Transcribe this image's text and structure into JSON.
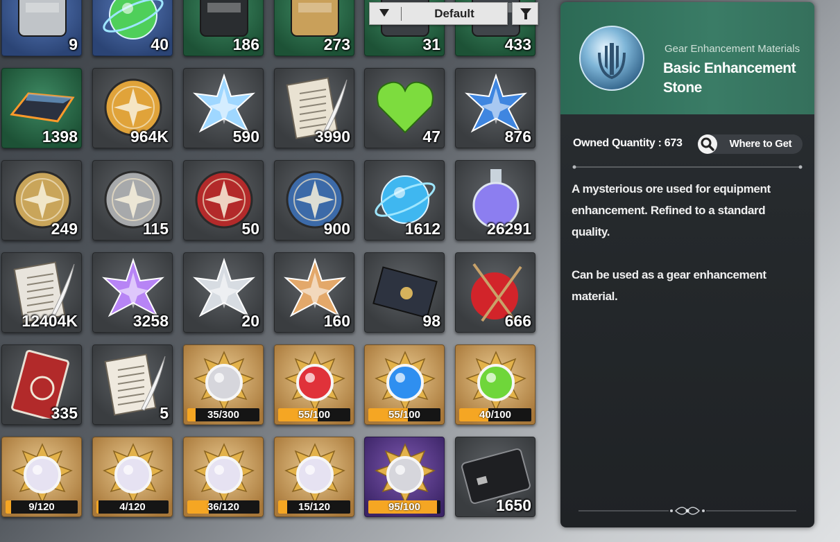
{
  "toolbar": {
    "sort_label": "Default"
  },
  "inventory": {
    "rows": [
      {
        "cut": true,
        "items": [
          {
            "qty": "9",
            "rarity": "blue",
            "icon": "knife-icon"
          },
          {
            "qty": "40",
            "rarity": "blue",
            "icon": "green-gem-icon"
          },
          {
            "qty": "186",
            "rarity": "green",
            "icon": "device-icon"
          },
          {
            "qty": "273",
            "rarity": "green",
            "icon": "brass-gear-icon"
          },
          {
            "qty": "31",
            "rarity": "green",
            "icon": "dark-blade-icon"
          },
          {
            "qty": "433",
            "rarity": "green",
            "icon": "dark-gadget-icon"
          }
        ]
      },
      {
        "items": [
          {
            "qty": "1398",
            "rarity": "green",
            "icon": "dark-ingot-icon"
          },
          {
            "qty": "964K",
            "rarity": "grey",
            "icon": "gold-coin-icon"
          },
          {
            "qty": "590",
            "rarity": "grey",
            "icon": "rainbow-crystal-icon"
          },
          {
            "qty": "3990",
            "rarity": "grey",
            "icon": "document-icon"
          },
          {
            "qty": "47",
            "rarity": "grey",
            "icon": "green-heart-icon"
          },
          {
            "qty": "876",
            "rarity": "grey",
            "icon": "blue-star-crystal-icon"
          }
        ]
      },
      {
        "items": [
          {
            "qty": "249",
            "rarity": "grey",
            "icon": "gold-compass-medal-icon"
          },
          {
            "qty": "115",
            "rarity": "grey",
            "icon": "crossed-axes-medal-icon"
          },
          {
            "qty": "50",
            "rarity": "grey",
            "icon": "red-eye-medal-icon"
          },
          {
            "qty": "900",
            "rarity": "grey",
            "icon": "blue-emblem-medal-icon"
          },
          {
            "qty": "1612",
            "rarity": "grey",
            "icon": "blue-orb-icon"
          },
          {
            "qty": "26291",
            "rarity": "grey",
            "icon": "potion-flask-icon"
          }
        ]
      },
      {
        "items": [
          {
            "qty": "12404K",
            "rarity": "grey",
            "icon": "quill-papers-icon"
          },
          {
            "qty": "3258",
            "rarity": "grey",
            "icon": "purple-star-crystal-icon"
          },
          {
            "qty": "20",
            "rarity": "grey",
            "icon": "silver-star-emblem-icon"
          },
          {
            "qty": "160",
            "rarity": "grey",
            "icon": "gold-star-emblem-icon"
          },
          {
            "qty": "98",
            "rarity": "grey",
            "icon": "sealed-envelope-icon"
          },
          {
            "qty": "666",
            "rarity": "grey",
            "icon": "yarn-ball-icon"
          }
        ]
      },
      {
        "items": [
          {
            "qty": "335",
            "rarity": "grey",
            "icon": "guild-ticket-icon"
          },
          {
            "qty": "5",
            "rarity": "grey",
            "icon": "scroll-quill-icon"
          },
          {
            "progress": "35/300",
            "fraction": 0.1167,
            "rarity": "gold",
            "icon": "silver-compass-orb-icon"
          },
          {
            "progress": "55/100",
            "fraction": 0.55,
            "rarity": "gold",
            "icon": "red-compass-orb-icon"
          },
          {
            "progress": "55/100",
            "fraction": 0.55,
            "rarity": "gold",
            "icon": "blue-compass-orb-icon"
          },
          {
            "progress": "40/100",
            "fraction": 0.4,
            "rarity": "gold",
            "icon": "green-compass-orb-icon"
          }
        ]
      },
      {
        "items": [
          {
            "progress": "9/120",
            "fraction": 0.075,
            "rarity": "gold",
            "icon": "character-orb-icon"
          },
          {
            "progress": "4/120",
            "fraction": 0.033,
            "rarity": "gold",
            "icon": "character-orb-icon"
          },
          {
            "progress": "36/120",
            "fraction": 0.3,
            "rarity": "gold",
            "icon": "character-orb-icon"
          },
          {
            "progress": "15/120",
            "fraction": 0.125,
            "rarity": "gold",
            "icon": "character-orb-icon"
          },
          {
            "progress": "95/100",
            "fraction": 0.95,
            "rarity": "purple",
            "icon": "silver-compass-orb-icon"
          },
          {
            "qty": "1650",
            "rarity": "grey",
            "icon": "black-card-icon"
          }
        ]
      }
    ]
  },
  "detail": {
    "category": "Gear Enhancement Materials",
    "name": "Basic Enhancement Stone",
    "owned": "Owned Quantity : 673",
    "where_label": "Where to Get",
    "description": [
      "A mysterious ore used for equipment enhancement. Refined to a standard quality.",
      "Can be used as a gear enhancement material."
    ]
  },
  "colors": {
    "header_green": "#3a7c66",
    "panel_dark": "#24282b",
    "progress_fill": "#f5a623",
    "sort_button": "#e6e6e6"
  }
}
